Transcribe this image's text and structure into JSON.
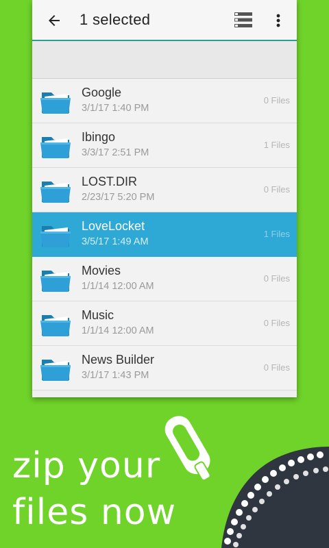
{
  "appbar": {
    "title": "1 selected",
    "back_icon": "arrow-left-icon",
    "view_icon": "list-view-icon",
    "menu_icon": "more-vert-icon",
    "accent_color": "#2a9d8f"
  },
  "files": [
    {
      "name": "Google",
      "date": "3/1/17 1:40 PM",
      "count": "0 Files",
      "selected": false
    },
    {
      "name": "Ibingo",
      "date": "3/3/17 2:51 PM",
      "count": "1 Files",
      "selected": false
    },
    {
      "name": "LOST.DIR",
      "date": "2/23/17 5:20 PM",
      "count": "0 Files",
      "selected": false
    },
    {
      "name": "LoveLocket",
      "date": "3/5/17 1:49 AM",
      "count": "1 Files",
      "selected": true
    },
    {
      "name": "Movies",
      "date": "1/1/14 12:00 AM",
      "count": "0 Files",
      "selected": false
    },
    {
      "name": "Music",
      "date": "1/1/14 12:00 AM",
      "count": "0 Files",
      "selected": false
    },
    {
      "name": "News Builder",
      "date": "3/1/17 1:43 PM",
      "count": "0 Files",
      "selected": false
    }
  ],
  "promo": {
    "line1": "zip your",
    "line2": "files now",
    "background_color": "#6fd32a",
    "selection_color": "#2ea9d6"
  }
}
